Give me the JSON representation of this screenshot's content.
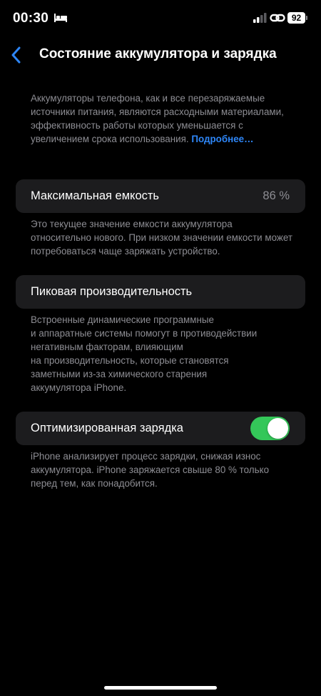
{
  "status_bar": {
    "time": "00:30",
    "battery": "92",
    "icons": [
      "bed-icon",
      "cellular-signal-icon",
      "personal-hotspot-icon",
      "battery-icon"
    ]
  },
  "nav": {
    "back_icon": "chevron-left-icon",
    "title": "Состояние аккумулятора и зарядка"
  },
  "intro": {
    "text": "Аккумуляторы телефона, как и все перезаряжаемые источники питания, являются расходными материалами, эффективность работы которых уменьшается с увеличением срока использования.",
    "link": "Подробнее…"
  },
  "max_capacity": {
    "label": "Максимальная емкость",
    "value": "86 %",
    "description": "Это текущее значение емкости аккумулятора относительно нового. При низком значении емкости может потребоваться чаще заряжать устройство."
  },
  "peak_performance": {
    "label": "Пиковая производительность",
    "description_lines": [
      "Встроенные динамические программные",
      "и аппаратные системы помогут в противодействии",
      "негативным факторам, влияющим",
      "на производительность, которые становятся",
      "заметными из-за химического старения",
      "аккумулятора iPhone."
    ]
  },
  "optimized_charging": {
    "label": "Оптимизированная зарядка",
    "enabled": true,
    "description": "iPhone анализирует процесс зарядки, снижая износ аккумулятора. iPhone заряжается свыше 80 % только перед тем, как понадобится."
  },
  "colors": {
    "background": "#000000",
    "card": "#1c1c1e",
    "secondary_text": "#8d8d93",
    "link": "#2e86f7",
    "toggle_on": "#34c759"
  }
}
